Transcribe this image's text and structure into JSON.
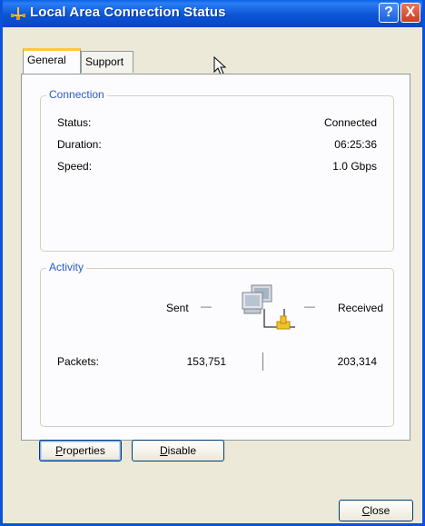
{
  "window": {
    "title": "Local Area Connection Status",
    "help_label": "?",
    "close_glyph": "X",
    "icon": "network-icon"
  },
  "tabs": [
    {
      "label": "General",
      "active": true
    },
    {
      "label": "Support",
      "active": false
    }
  ],
  "connection": {
    "group_label": "Connection",
    "status_label": "Status:",
    "status_value": "Connected",
    "duration_label": "Duration:",
    "duration_value": "06:25:36",
    "speed_label": "Speed:",
    "speed_value": "1.0 Gbps"
  },
  "activity": {
    "group_label": "Activity",
    "sent_label": "Sent",
    "received_label": "Received",
    "packets_label": "Packets:",
    "packets_sent": "153,751",
    "packets_received": "203,314",
    "dash": "—"
  },
  "buttons": {
    "properties_first": "P",
    "properties_rest": "roperties",
    "disable_first": "D",
    "disable_rest": "isable",
    "close_first": "C",
    "close_rest": "lose"
  },
  "colors": {
    "titlebar": "#0a53d9",
    "group_label": "#2d59c8",
    "active_tab_accent": "#ffc73c"
  }
}
